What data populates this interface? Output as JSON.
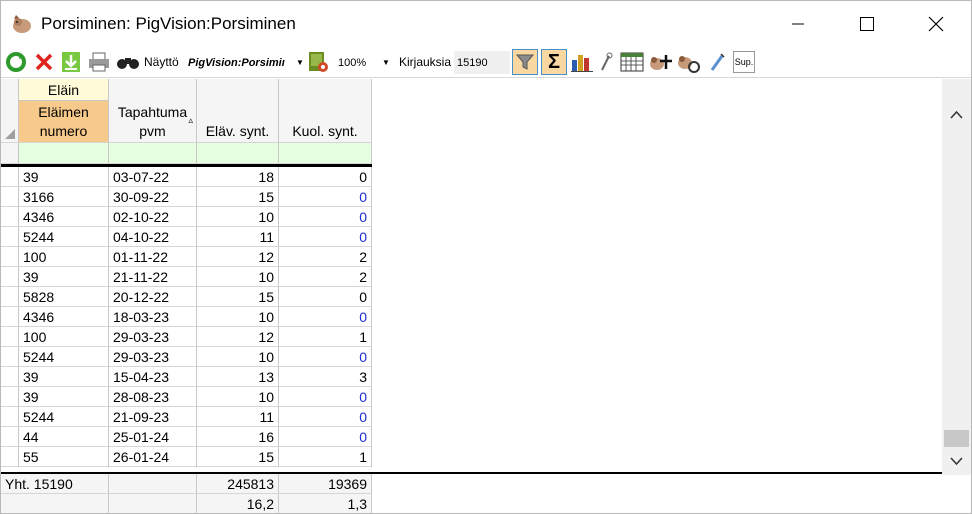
{
  "window": {
    "title": "Porsiminen: PigVision:Porsiminen"
  },
  "toolbar": {
    "view_label": "Näyttö",
    "view_value": "PigVision:Porsimiı",
    "zoom_value": "100%",
    "records_label": "Kirjauksia",
    "records_value": "15190",
    "sup_label": "Sup."
  },
  "table": {
    "group_header": "Eläin",
    "columns": [
      "Eläimen numero",
      "Tapahtuma pvm",
      "Eläv. synt.",
      "Kuol. synt."
    ],
    "rows": [
      {
        "id": "39",
        "date": "03-07-22",
        "live": "18",
        "dead": "0",
        "dead_blue": false
      },
      {
        "id": "3166",
        "date": "30-09-22",
        "live": "15",
        "dead": "0",
        "dead_blue": true
      },
      {
        "id": "4346",
        "date": "02-10-22",
        "live": "10",
        "dead": "0",
        "dead_blue": true
      },
      {
        "id": "5244",
        "date": "04-10-22",
        "live": "11",
        "dead": "0",
        "dead_blue": true
      },
      {
        "id": "100",
        "date": "01-11-22",
        "live": "12",
        "dead": "2",
        "dead_blue": false
      },
      {
        "id": "39",
        "date": "21-11-22",
        "live": "10",
        "dead": "2",
        "dead_blue": false
      },
      {
        "id": "5828",
        "date": "20-12-22",
        "live": "15",
        "dead": "0",
        "dead_blue": false
      },
      {
        "id": "4346",
        "date": "18-03-23",
        "live": "10",
        "dead": "0",
        "dead_blue": true
      },
      {
        "id": "100",
        "date": "29-03-23",
        "live": "12",
        "dead": "1",
        "dead_blue": false
      },
      {
        "id": "5244",
        "date": "29-03-23",
        "live": "10",
        "dead": "0",
        "dead_blue": true
      },
      {
        "id": "39",
        "date": "15-04-23",
        "live": "13",
        "dead": "3",
        "dead_blue": false
      },
      {
        "id": "39",
        "date": "28-08-23",
        "live": "10",
        "dead": "0",
        "dead_blue": true
      },
      {
        "id": "5244",
        "date": "21-09-23",
        "live": "11",
        "dead": "0",
        "dead_blue": true
      },
      {
        "id": "44",
        "date": "25-01-24",
        "live": "16",
        "dead": "0",
        "dead_blue": true
      },
      {
        "id": "55",
        "date": "26-01-24",
        "live": "15",
        "dead": "1",
        "dead_blue": false
      }
    ],
    "totals": {
      "label": "Yht. 15190",
      "live_sum": "245813",
      "dead_sum": "19369",
      "live_avg": "16,2",
      "dead_avg": "1,3"
    }
  },
  "colors": {
    "header_orange": "#f7c98a",
    "header_yellow": "#fffbd8",
    "filter_green": "#e6ffe0",
    "blue_value": "#1d2bd6",
    "toolbar_active": "#f9d7a0"
  }
}
